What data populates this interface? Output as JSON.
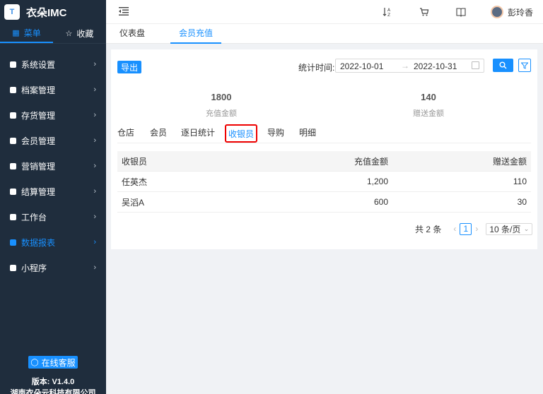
{
  "app": {
    "logo_text": "衣朵IMC",
    "logo_badge": "T"
  },
  "sidebar": {
    "tabs": [
      {
        "icon": "grid-icon",
        "label": "菜单"
      },
      {
        "icon": "star-icon",
        "label": "收藏"
      }
    ],
    "items": [
      {
        "label": "系统设置",
        "active": false
      },
      {
        "label": "档案管理",
        "active": false
      },
      {
        "label": "存货管理",
        "active": false
      },
      {
        "label": "会员管理",
        "active": false
      },
      {
        "label": "营销管理",
        "active": false
      },
      {
        "label": "结算管理",
        "active": false
      },
      {
        "label": "工作台",
        "active": false
      },
      {
        "label": "数据报表",
        "active": true
      },
      {
        "label": "小程序",
        "active": false
      }
    ],
    "service_label": "在线客服",
    "version": "版本: V1.4.0",
    "company": "湖南衣朵云科技有限公司"
  },
  "header": {
    "user_name": "彭玲香"
  },
  "page_tabs": [
    {
      "label": "仪表盘"
    },
    {
      "label": "会员充值"
    }
  ],
  "toolbar": {
    "export_label": "导出",
    "stat_time_label": "统计时间:",
    "date_start": "2022-10-01",
    "date_arrow": "→",
    "date_end": "2022-10-31"
  },
  "summary": [
    {
      "value": "1800",
      "label": "充值金额"
    },
    {
      "value": "140",
      "label": "赠送金额"
    }
  ],
  "sub_tabs": [
    {
      "label": "仓店"
    },
    {
      "label": "会员"
    },
    {
      "label": "逐日统计"
    },
    {
      "label": "收银员"
    },
    {
      "label": "导购"
    },
    {
      "label": "明细"
    }
  ],
  "table": {
    "headers": [
      "收银员",
      "充值金额",
      "赠送金额"
    ],
    "rows": [
      [
        "任英杰",
        "1,200",
        "110"
      ],
      [
        "吴滔A",
        "600",
        "30"
      ]
    ]
  },
  "pagination": {
    "total_label": "共 2 条",
    "current_page": "1",
    "page_size": "10 条/页"
  },
  "colors": {
    "accent": "#1890ff",
    "sidebar_bg": "#1f2d3d",
    "highlight_border": "#e00"
  }
}
